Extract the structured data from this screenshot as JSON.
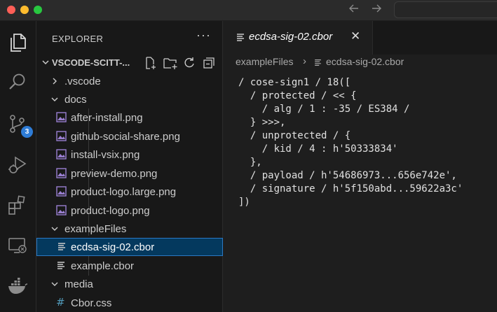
{
  "titlebar": {
    "back_icon": "arrow-left-icon",
    "forward_icon": "arrow-right-icon"
  },
  "activity_bar": {
    "items": [
      {
        "name": "explorer",
        "icon": "files-icon"
      },
      {
        "name": "search",
        "icon": "search-icon"
      },
      {
        "name": "source-control",
        "icon": "source-control-icon",
        "badge": "3"
      },
      {
        "name": "run-and-debug",
        "icon": "debug-icon"
      },
      {
        "name": "extensions",
        "icon": "extensions-icon"
      },
      {
        "name": "remote-explorer",
        "icon": "remote-explorer-icon"
      },
      {
        "name": "docker",
        "icon": "docker-icon"
      }
    ],
    "accent": "#2e7cd6"
  },
  "sidebar": {
    "title": "EXPLORER",
    "more": "···",
    "folder_name": "VSCODE-SCITT-...",
    "tree": [
      {
        "label": ".vscode",
        "type": "folder",
        "expanded": false
      },
      {
        "label": "docs",
        "type": "folder",
        "expanded": true
      },
      {
        "label": "after-install.png",
        "type": "image"
      },
      {
        "label": "github-social-share.png",
        "type": "image"
      },
      {
        "label": "install-vsix.png",
        "type": "image"
      },
      {
        "label": "preview-demo.png",
        "type": "image"
      },
      {
        "label": "product-logo.large.png",
        "type": "image"
      },
      {
        "label": "product-logo.png",
        "type": "image"
      },
      {
        "label": "exampleFiles",
        "type": "folder",
        "expanded": true
      },
      {
        "label": "ecdsa-sig-02.cbor",
        "type": "file",
        "selected": true
      },
      {
        "label": "example.cbor",
        "type": "file"
      },
      {
        "label": "media",
        "type": "folder",
        "expanded": true
      },
      {
        "label": "Cbor.css",
        "type": "css"
      }
    ],
    "image_icon_color": "#9a7fd1",
    "selection_color": "#04395e"
  },
  "editor": {
    "tab_label": "ecdsa-sig-02.cbor",
    "tab_close": "✕",
    "breadcrumb": {
      "folder": "exampleFiles",
      "separator": "›",
      "file": "ecdsa-sig-02.cbor"
    },
    "code_lines": [
      "/ cose-sign1 / 18([",
      "  / protected / << {",
      "    / alg / 1 : -35 / ES384 /",
      "  } >>>,",
      "  / unprotected / {",
      "    / kid / 4 : h'50333834'",
      "  },",
      "  / payload / h'54686973...656e742e',",
      "  / signature / h'5f150abd...59622a3c'",
      "])"
    ]
  }
}
